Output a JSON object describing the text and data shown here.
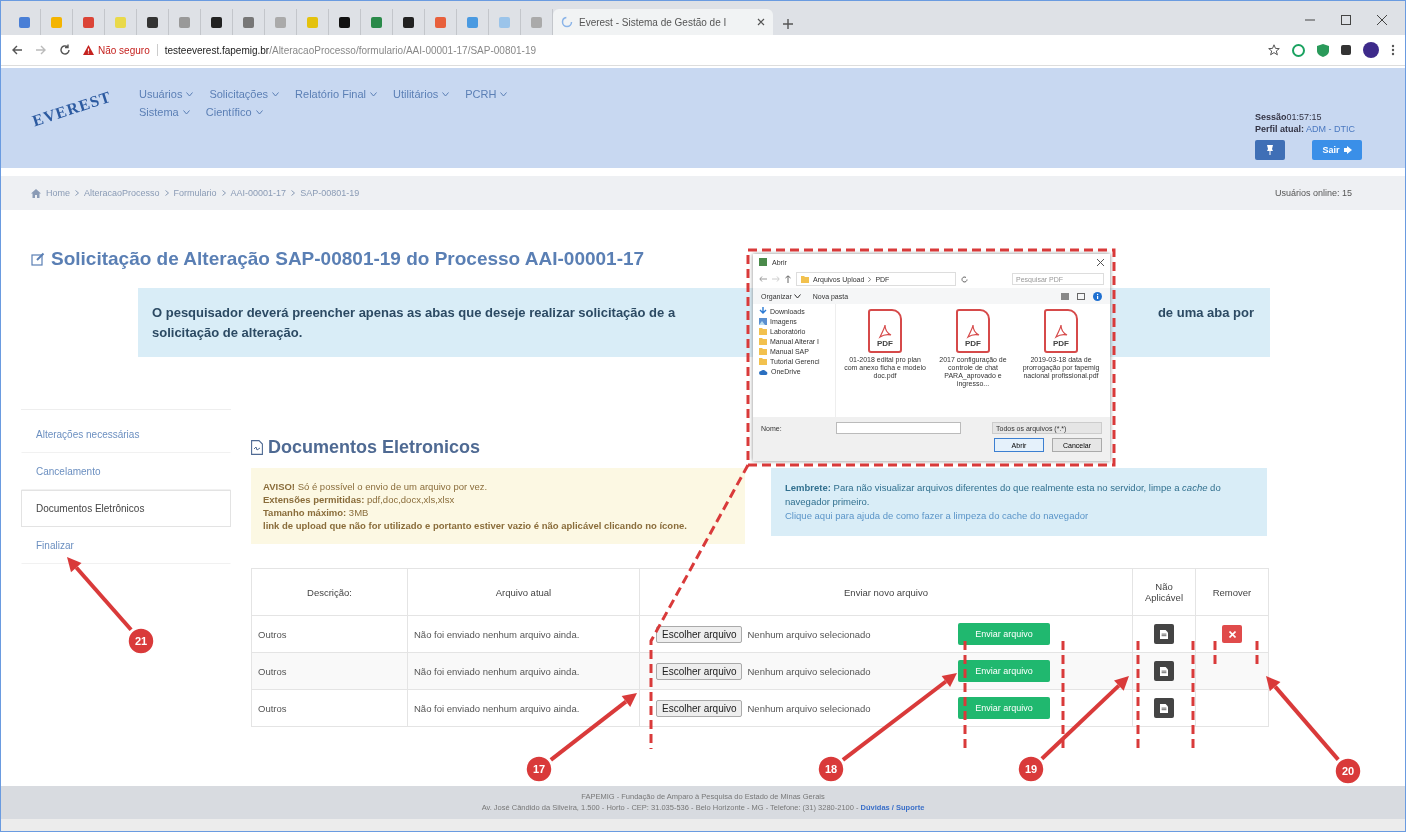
{
  "browser": {
    "tab_title": "Everest - Sistema de Gestão de I",
    "security": "Não seguro",
    "url_host": "testeeverest.fapemig.br",
    "url_path": "/AlteracaoProcesso/formulario/AAI-00001-17/SAP-00801-19"
  },
  "header": {
    "logo": "EVEREST",
    "menu": [
      [
        {
          "label": "Usuários"
        },
        {
          "label": "Solicitações"
        },
        {
          "label": "Relatório Final"
        },
        {
          "label": "Utilitários"
        },
        {
          "label": "PCRH"
        }
      ],
      [
        {
          "label": "Sistema"
        },
        {
          "label": "Científico"
        }
      ]
    ],
    "session_label": "Sessão",
    "session_time": "01:57:15",
    "profile_label": "Perfil atual:",
    "profile_value": "ADM - DTIC",
    "logout": "Sair"
  },
  "breadcrumb": {
    "items": [
      "Home",
      "AlteracaoProcesso",
      "Formulario",
      "AAI-00001-17",
      "SAP-00801-19"
    ],
    "online": "Usuários online: 15"
  },
  "title": "Solicitação de Alteração SAP-00801-19 do Processo AAI-00001-17",
  "notice": {
    "lines": [
      "O pesquisador deverá preencher apenas as abas que deseje realizar solicitação de a",
      "solicitação de alteração."
    ],
    "right_fragment": "de uma aba por"
  },
  "sidebar": {
    "items": [
      {
        "label": "Alterações necessárias",
        "selected": false
      },
      {
        "label": "Cancelamento",
        "selected": false
      },
      {
        "label": "Documentos Eletrônicos",
        "selected": true
      },
      {
        "label": "Finalizar",
        "selected": false
      }
    ]
  },
  "section_title": "Documentos Eletronicos",
  "warning": {
    "lines": [
      {
        "text": "**AVISO!** Só é possível o envio de um arquivo por vez.",
        "bold": false
      },
      {
        "text": "**Extensões permitidas:** pdf,doc,docx,xls,xlsx",
        "bold": false
      },
      {
        "text": "**Tamanho máximo:** 3MB",
        "bold": false
      },
      {
        "text": "link de upload que não for utilizado e portanto estiver vazio é não aplicável clicando no ícone.",
        "bold": true
      }
    ]
  },
  "reminder": {
    "text": "**Lembrete:** Para não visualizar arquivos diferentes do que realmente esta no servidor, limpe a *cache* do navegador primeiro.",
    "link": "Clique aqui para ajuda de como fazer a limpeza do cache do navegador"
  },
  "table": {
    "columns": [
      "Descrição:",
      "Arquivo atual",
      "Enviar novo arquivo",
      "Não Aplicável",
      "Remover"
    ],
    "rows": [
      {
        "description": "Outros",
        "current_file": "Não foi enviado nenhum arquivo ainda.",
        "choose_button": "Escolher arquivo",
        "chosen": "Nenhum arquivo selecionado",
        "send_button": "Enviar arquivo",
        "removable": true
      },
      {
        "description": "Outros",
        "current_file": "Não foi enviado nenhum arquivo ainda.",
        "choose_button": "Escolher arquivo",
        "chosen": "Nenhum arquivo selecionado",
        "send_button": "Enviar arquivo",
        "removable": false
      },
      {
        "description": "Outros",
        "current_file": "Não foi enviado nenhum arquivo ainda.",
        "choose_button": "Escolher arquivo",
        "chosen": "Nenhum arquivo selecionado",
        "send_button": "Enviar arquivo",
        "removable": false
      }
    ]
  },
  "footer": {
    "line1": "FAPEMIG - Fundação de Amparo à Pesquisa do Estado de Minas Gerais",
    "line2": "Av. José Cândido da Silveira, 1.500 - Horto - CEP: 31.035-536 - Belo Horizonte - MG - Telefone: (31) 3280-2100 -",
    "link": "Dúvidas / Suporte"
  },
  "file_dialog": {
    "title": "Abrir",
    "path": [
      "Arquivos Upload",
      "PDF"
    ],
    "search_placeholder": "Pesquisar PDF",
    "organize": "Organizar",
    "new_folder": "Nova pasta",
    "nav": [
      {
        "label": "Downloads",
        "kind": "download"
      },
      {
        "label": "Imagens",
        "kind": "images"
      },
      {
        "label": "Laboratório",
        "kind": "folder"
      },
      {
        "label": "Manual Alterar I",
        "kind": "folder"
      },
      {
        "label": "Manual SAP",
        "kind": "folder"
      },
      {
        "label": "Tutorial Gerenci",
        "kind": "folder"
      },
      {
        "label": "OneDrive",
        "kind": "cloud"
      }
    ],
    "files": [
      {
        "badge": "PDF",
        "name": "01-2018 edital pro plan com anexo ficha e modelo doc.pdf"
      },
      {
        "badge": "PDF",
        "name": "2017 configuração de controle de chat PARA_aprovado e ingresso..."
      },
      {
        "badge": "PDF",
        "name": "2019-03-18 data de prorrogação por fapemig nacional profissional.pdf"
      }
    ],
    "name_label": "Nome:",
    "filter": "Todos os arquivos (*.*)",
    "open_button": "Abrir",
    "cancel_button": "Cancelar"
  },
  "callouts": [
    {
      "label": "17"
    },
    {
      "label": "18"
    },
    {
      "label": "19"
    },
    {
      "label": "20"
    },
    {
      "label": "21"
    }
  ]
}
